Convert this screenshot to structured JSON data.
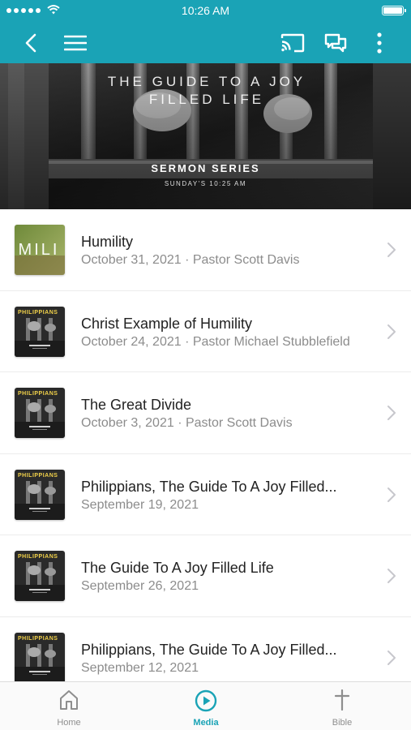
{
  "status_bar": {
    "time": "10:26 AM",
    "icons": [
      "signal-dots-icon",
      "wifi-icon",
      "battery-icon"
    ]
  },
  "nav": {
    "icons": [
      "back-arrow-icon",
      "hamburger-menu-icon",
      "cast-icon",
      "chat-bubbles-icon",
      "more-vertical-icon"
    ]
  },
  "banner": {
    "title": "THE GUIDE TO A JOY FILLED LIFE",
    "subtitle": "SERMON SERIES",
    "time": "SUNDAY'S 10:25 AM"
  },
  "sermons": [
    {
      "title": "Humility",
      "meta": "October 31, 2021 · Pastor Scott Davis",
      "thumb_text": "IMILI"
    },
    {
      "title": "Christ Example of Humility",
      "meta": "October 24, 2021 · Pastor Michael Stubblefield",
      "thumb_text": "PHILIPPIANS"
    },
    {
      "title": "The Great Divide",
      "meta": "October 3, 2021 · Pastor Scott Davis",
      "thumb_text": "PHILIPPIANS"
    },
    {
      "title": "Philippians, The Guide To A Joy Filled...",
      "meta": "September 19, 2021",
      "thumb_text": "PHILIPPIANS"
    },
    {
      "title": "The Guide To A Joy Filled Life",
      "meta": "September 26, 2021",
      "thumb_text": "PHILIPPIANS"
    },
    {
      "title": "Philippians, The Guide To A Joy Filled...",
      "meta": "September 12, 2021",
      "thumb_text": "PHILIPPIANS"
    }
  ],
  "tabs": [
    {
      "label": "Home",
      "icon": "home-icon",
      "active": false
    },
    {
      "label": "Media",
      "icon": "play-circle-icon",
      "active": true
    },
    {
      "label": "Bible",
      "icon": "cross-icon",
      "active": false
    }
  ],
  "colors": {
    "accent": "#1aa3b6",
    "meta_text": "#8c8c8c",
    "inactive_tab": "#8e8e8e"
  }
}
